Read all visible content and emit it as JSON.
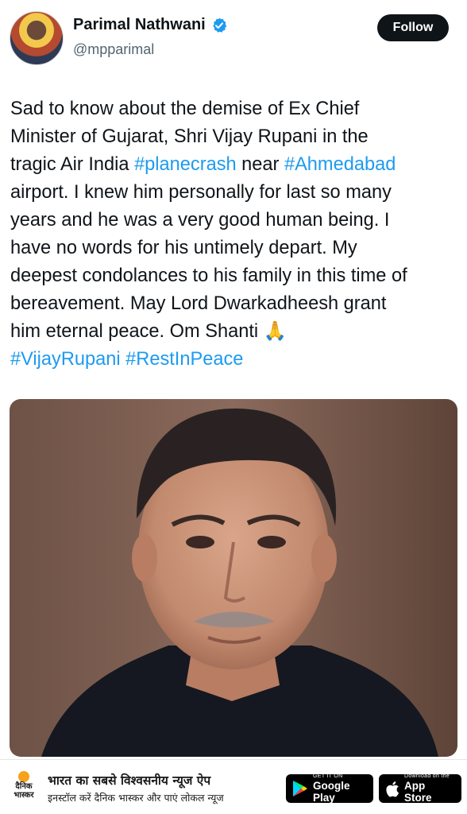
{
  "author": {
    "display_name": "Parimal Nathwani",
    "handle": "@mpparimal",
    "verified_color": "#1d9bf0"
  },
  "follow_label": "Follow",
  "tweet": {
    "lines": [
      [
        {
          "text": "Sad to know about the demise of Ex Chief"
        }
      ],
      [
        {
          "text": "Minister of Gujarat, Shri Vijay Rupani in the"
        }
      ],
      [
        {
          "text": "tragic Air India "
        },
        {
          "text": "#planecrash",
          "tag": true
        },
        {
          "text": " near "
        },
        {
          "text": "#Ahmedabad",
          "tag": true
        }
      ],
      [
        {
          "text": "airport. I knew him personally for last so many"
        }
      ],
      [
        {
          "text": "years and he was a very good human being. I"
        }
      ],
      [
        {
          "text": "have no words for his untimely depart. My"
        }
      ],
      [
        {
          "text": "deepest condolances to his family in this time of"
        }
      ],
      [
        {
          "text": "bereavement. May Lord Dwarkadheesh grant"
        }
      ],
      [
        {
          "text": "him eternal peace. Om Shanti 🙏"
        }
      ],
      [
        {
          "text": "#VijayRupani",
          "tag": true
        },
        {
          "text": " "
        },
        {
          "text": "#RestInPeace",
          "tag": true
        }
      ]
    ]
  },
  "banner": {
    "logo_text": "दैनिक भास्कर",
    "line1": "भारत का सबसे विश्वसनीय न्यूज ऐप",
    "line2": "इनस्टॉल करें दैनिक भास्कर और पाएं लोकल न्यूज",
    "google_play_small": "GET IT ON",
    "google_play_big": "Google Play",
    "app_store_small": "Download on the",
    "app_store_big": "App Store"
  },
  "colors": {
    "hashtag": "#1d9bf0",
    "text": "#0f1419",
    "handle": "#536471"
  }
}
